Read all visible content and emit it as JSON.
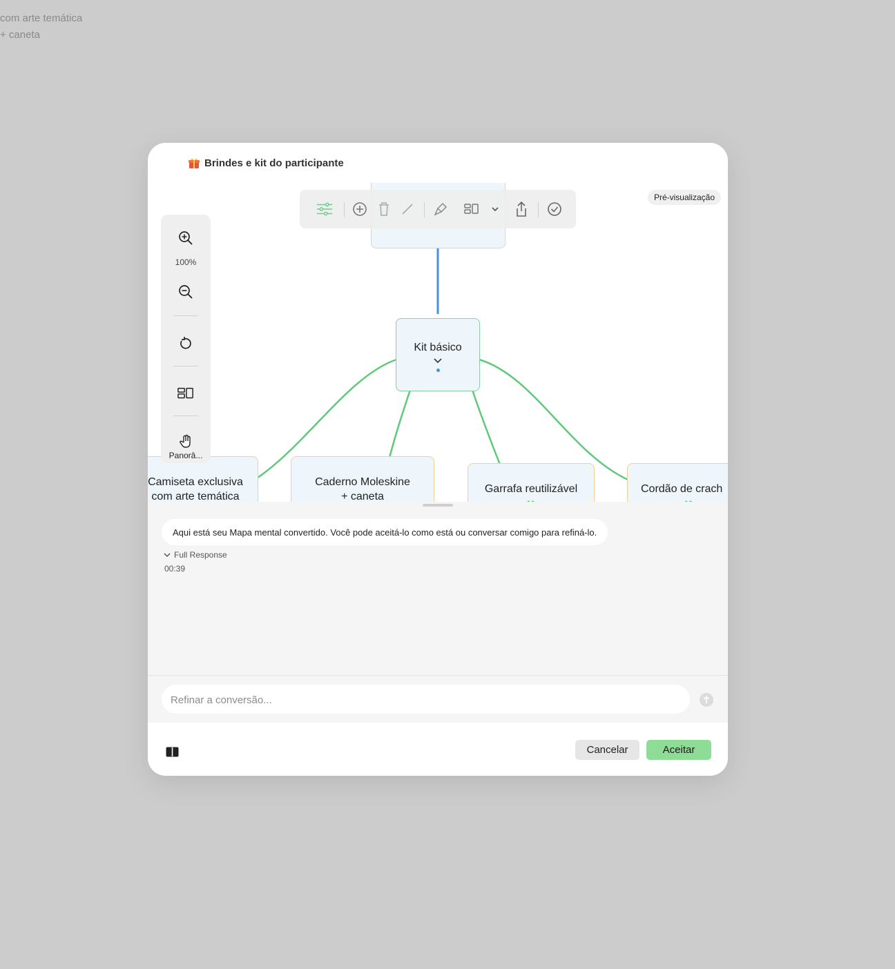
{
  "background": {
    "lines": [
      "com arte temática",
      "+ caneta"
    ]
  },
  "dialog": {
    "title": "Brindes e kit do participante",
    "title_icon": "gift-icon"
  },
  "canvas": {
    "preview_badge": "Pré-visualização",
    "zoom_level": "100%",
    "pan_label": "Panorâ...",
    "toolbar_icons": [
      "sliders-icon",
      "add-circle-icon",
      "trash-icon",
      "line-icon",
      "paint-brush-icon",
      "layout-icon",
      "chevron-down-icon",
      "share-icon",
      "check-circle-icon"
    ],
    "side_icons": [
      "zoom-in-icon",
      "zoom-out-icon",
      "reset-icon",
      "layout-icon",
      "pan-hand-icon"
    ],
    "center_node": "Kit básico",
    "leaf_nodes": [
      {
        "line1": "Camiseta exclusiva",
        "line2": "com arte temática"
      },
      {
        "line1": "Caderno Moleskine",
        "line2": "+ caneta"
      },
      {
        "line1": "Garrafa reutilizável",
        "line2": ""
      },
      {
        "line1": "Cordão de crach",
        "line2": ""
      }
    ]
  },
  "chat": {
    "message": "Aqui está seu Mapa mental convertido. Você pode aceitá-lo como está ou conversar comigo para refiná-lo.",
    "full_response_label": "Full Response",
    "timestamp": "00:39",
    "input_placeholder": "Refinar a conversão..."
  },
  "footer": {
    "cancel_label": "Cancelar",
    "accept_label": "Aceitar"
  },
  "colors": {
    "accent_green": "#8fdc96",
    "link_green": "#5fc97a",
    "link_blue": "#4a90d9",
    "leaf_border": "#f3cf95"
  }
}
